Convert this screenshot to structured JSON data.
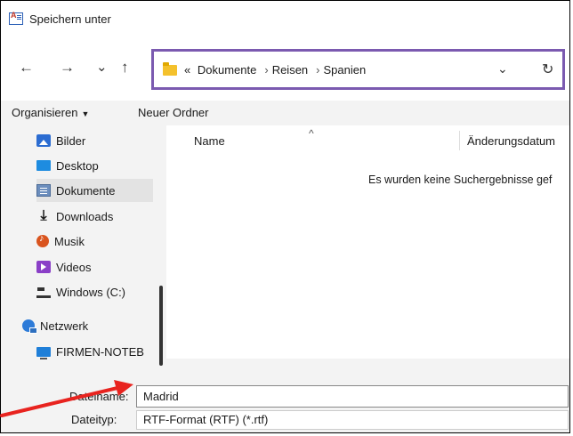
{
  "window": {
    "title": "Speichern unter"
  },
  "nav": {
    "back": "←",
    "forward": "→",
    "recent": "⌄",
    "up": "↑"
  },
  "address": {
    "prefix": "«",
    "crumbs": [
      "Dokumente",
      "Reisen",
      "Spanien"
    ],
    "dropdown": "⌄",
    "refresh": "↻"
  },
  "toolbar": {
    "organize": "Organisieren",
    "new_folder": "Neuer Ordner"
  },
  "sidebar": {
    "items": [
      {
        "label": "Bilder",
        "icon": "pictures-icon"
      },
      {
        "label": "Desktop",
        "icon": "desktop-icon"
      },
      {
        "label": "Dokumente",
        "icon": "documents-icon",
        "selected": true
      },
      {
        "label": "Downloads",
        "icon": "download-icon"
      },
      {
        "label": "Musik",
        "icon": "music-icon"
      },
      {
        "label": "Videos",
        "icon": "videos-icon"
      },
      {
        "label": "Windows (C:)",
        "icon": "drive-icon"
      },
      {
        "label": "Netzwerk",
        "icon": "network-icon"
      },
      {
        "label": "FIRMEN-NOTEB",
        "icon": "computer-icon"
      }
    ]
  },
  "content": {
    "columns": {
      "name": "Name",
      "date": "Änderungsdatum"
    },
    "empty_message": "Es wurden keine Suchergebnisse gef"
  },
  "form": {
    "filename_label": "Dateiname:",
    "filename_value": "Madrid",
    "filetype_label": "Dateityp:",
    "filetype_value": "RTF-Format (RTF) (*.rtf)"
  },
  "colors": {
    "highlight_border": "#7b5ab0",
    "annotation_arrow": "#e8231f"
  }
}
